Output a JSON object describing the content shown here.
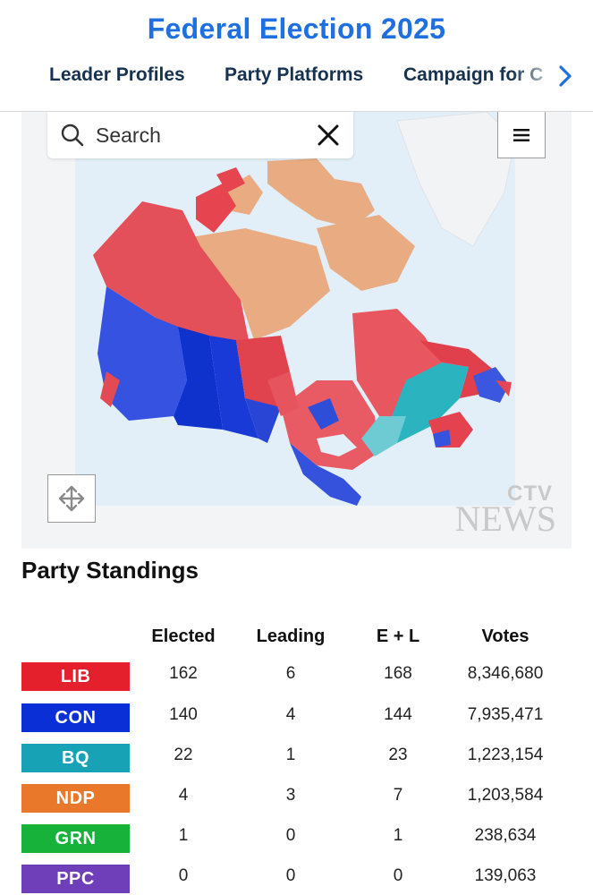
{
  "header": {
    "title": "Federal Election 2025",
    "nav": [
      "Leader Profiles",
      "Party Platforms",
      "Campaign for C"
    ]
  },
  "map": {
    "search_placeholder": "Search",
    "logo_top": "CTV",
    "logo_bottom": "NEWS"
  },
  "standings": {
    "title": "Party Standings",
    "columns": [
      "Elected",
      "Leading",
      "E + L",
      "Votes"
    ],
    "rows": [
      {
        "party": "LIB",
        "color": "#e3202c",
        "elected": "162",
        "leading": "6",
        "el": "168",
        "votes": "8,346,680"
      },
      {
        "party": "CON",
        "color": "#0a2fd6",
        "elected": "140",
        "leading": "4",
        "el": "144",
        "votes": "7,935,471"
      },
      {
        "party": "BQ",
        "color": "#17a3b5",
        "elected": "22",
        "leading": "1",
        "el": "23",
        "votes": "1,223,154"
      },
      {
        "party": "NDP",
        "color": "#e9782a",
        "elected": "4",
        "leading": "3",
        "el": "7",
        "votes": "1,203,584"
      },
      {
        "party": "GRN",
        "color": "#16b23a",
        "elected": "1",
        "leading": "0",
        "el": "1",
        "votes": "238,634"
      },
      {
        "party": "PPC",
        "color": "#6e3fb8",
        "elected": "0",
        "leading": "0",
        "el": "0",
        "votes": "139,063"
      }
    ]
  }
}
